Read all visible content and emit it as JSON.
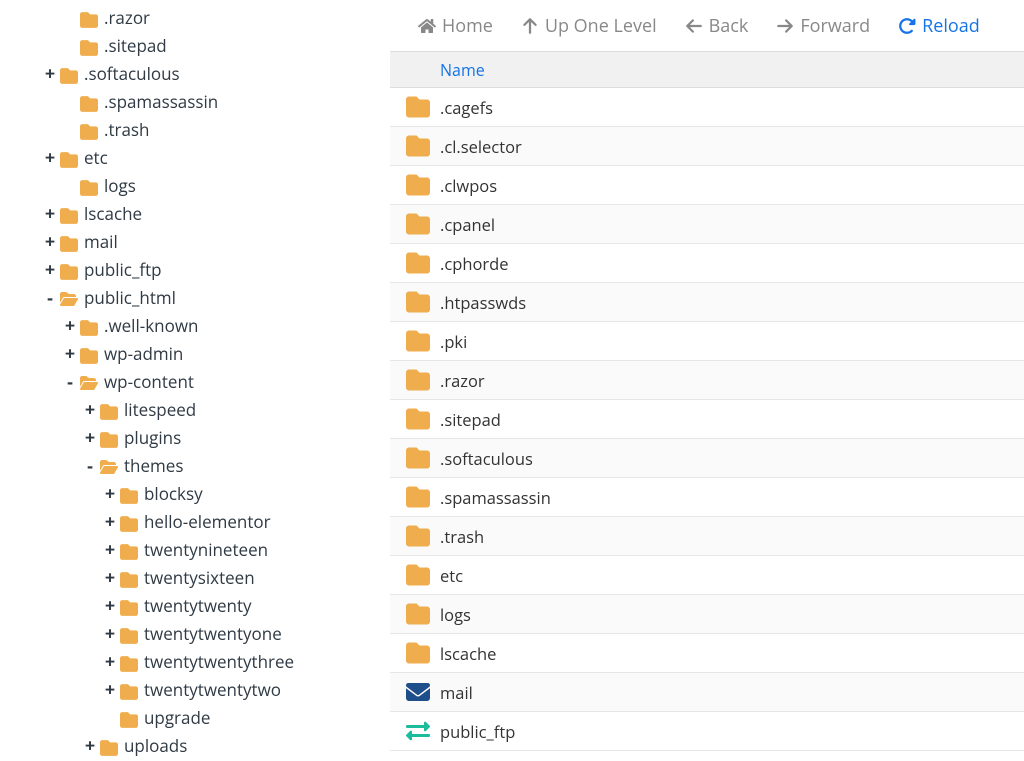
{
  "toolbar": {
    "home": "Home",
    "up": "Up One Level",
    "back": "Back",
    "forward": "Forward",
    "reload": "Reload"
  },
  "header": {
    "name": "Name"
  },
  "tree": [
    {
      "indent": 2,
      "toggle": "",
      "open": false,
      "label": ".razor"
    },
    {
      "indent": 2,
      "toggle": "",
      "open": false,
      "label": ".sitepad"
    },
    {
      "indent": 1,
      "toggle": "+",
      "open": false,
      "label": ".softaculous"
    },
    {
      "indent": 2,
      "toggle": "",
      "open": false,
      "label": ".spamassassin"
    },
    {
      "indent": 2,
      "toggle": "",
      "open": false,
      "label": ".trash"
    },
    {
      "indent": 1,
      "toggle": "+",
      "open": false,
      "label": "etc"
    },
    {
      "indent": 2,
      "toggle": "",
      "open": false,
      "label": "logs"
    },
    {
      "indent": 1,
      "toggle": "+",
      "open": false,
      "label": "lscache"
    },
    {
      "indent": 1,
      "toggle": "+",
      "open": false,
      "label": "mail"
    },
    {
      "indent": 1,
      "toggle": "+",
      "open": false,
      "label": "public_ftp"
    },
    {
      "indent": 1,
      "toggle": "-",
      "open": true,
      "label": "public_html"
    },
    {
      "indent": 2,
      "toggle": "+",
      "open": false,
      "label": ".well-known"
    },
    {
      "indent": 2,
      "toggle": "+",
      "open": false,
      "label": "wp-admin"
    },
    {
      "indent": 2,
      "toggle": "-",
      "open": true,
      "label": "wp-content"
    },
    {
      "indent": 3,
      "toggle": "+",
      "open": false,
      "label": "litespeed"
    },
    {
      "indent": 3,
      "toggle": "+",
      "open": false,
      "label": "plugins"
    },
    {
      "indent": 3,
      "toggle": "-",
      "open": true,
      "label": "themes"
    },
    {
      "indent": 4,
      "toggle": "+",
      "open": false,
      "label": "blocksy"
    },
    {
      "indent": 4,
      "toggle": "+",
      "open": false,
      "label": "hello-elementor"
    },
    {
      "indent": 4,
      "toggle": "+",
      "open": false,
      "label": "twentynineteen"
    },
    {
      "indent": 4,
      "toggle": "+",
      "open": false,
      "label": "twentysixteen"
    },
    {
      "indent": 4,
      "toggle": "+",
      "open": false,
      "label": "twentytwenty"
    },
    {
      "indent": 4,
      "toggle": "+",
      "open": false,
      "label": "twentytwentyone"
    },
    {
      "indent": 4,
      "toggle": "+",
      "open": false,
      "label": "twentytwentythree"
    },
    {
      "indent": 4,
      "toggle": "+",
      "open": false,
      "label": "twentytwentytwo"
    },
    {
      "indent": 4,
      "toggle": "",
      "open": false,
      "label": "upgrade"
    },
    {
      "indent": 3,
      "toggle": "+",
      "open": false,
      "label": "uploads"
    }
  ],
  "files": [
    {
      "icon": "folder",
      "label": ".cagefs"
    },
    {
      "icon": "folder",
      "label": ".cl.selector"
    },
    {
      "icon": "folder",
      "label": ".clwpos"
    },
    {
      "icon": "folder",
      "label": ".cpanel"
    },
    {
      "icon": "folder",
      "label": ".cphorde"
    },
    {
      "icon": "folder",
      "label": ".htpasswds"
    },
    {
      "icon": "folder",
      "label": ".pki"
    },
    {
      "icon": "folder",
      "label": ".razor"
    },
    {
      "icon": "folder",
      "label": ".sitepad"
    },
    {
      "icon": "folder",
      "label": ".softaculous"
    },
    {
      "icon": "folder",
      "label": ".spamassassin"
    },
    {
      "icon": "folder",
      "label": ".trash"
    },
    {
      "icon": "folder",
      "label": "etc"
    },
    {
      "icon": "folder",
      "label": "logs"
    },
    {
      "icon": "folder",
      "label": "lscache"
    },
    {
      "icon": "mail",
      "label": "mail"
    },
    {
      "icon": "ftp",
      "label": "public_ftp"
    }
  ]
}
